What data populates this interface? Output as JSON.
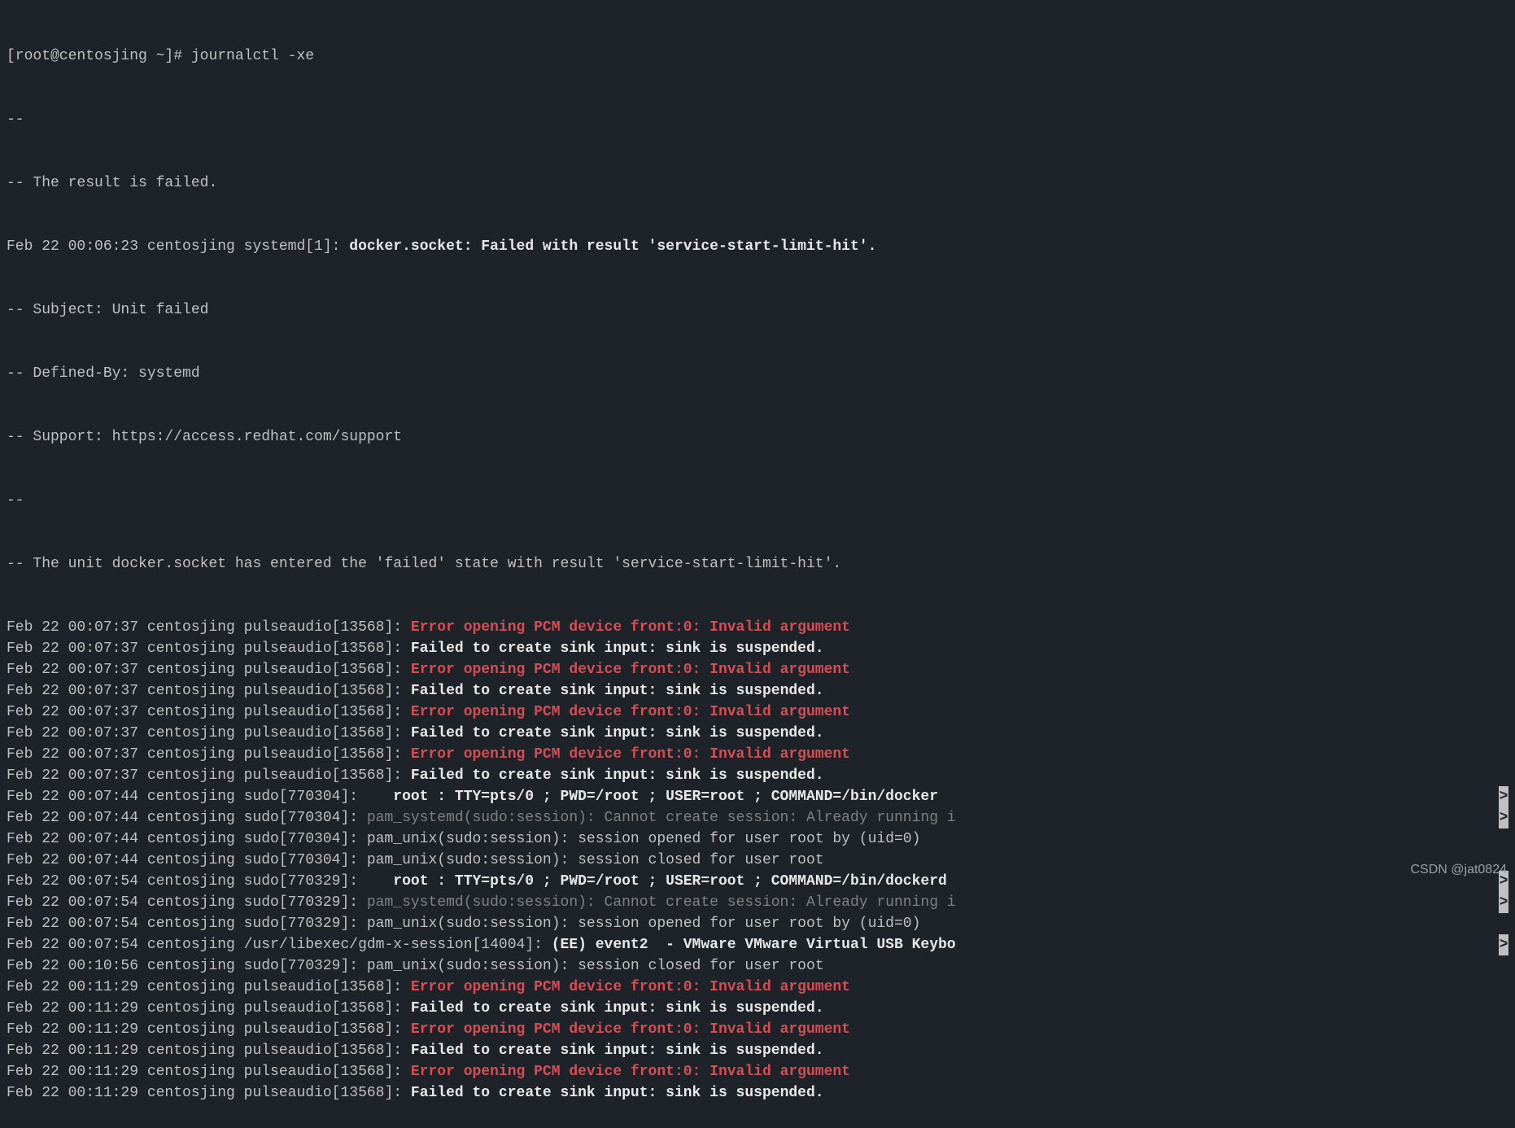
{
  "prompt": {
    "user_host": "[root@centosjing ~]# ",
    "command": "journalctl -xe"
  },
  "header": {
    "sep1": "--",
    "result": "-- The result is failed.",
    "docker_prefix": "Feb 22 00:06:23 centosjing systemd[1]: ",
    "docker_msg": "docker.socket: Failed with result 'service-start-limit-hit'.",
    "subject": "-- Subject: Unit failed",
    "defined": "-- Defined-By: systemd",
    "support": "-- Support: https://access.redhat.com/support",
    "sep2": "--",
    "unit_msg": "-- The unit docker.socket has entered the 'failed' state with result 'service-start-limit-hit'."
  },
  "lines": [
    {
      "prefix": "Feb 22 00:07:37 centosjing pulseaudio[13568]: ",
      "msg": "Error opening PCM device front:0: Invalid argument",
      "cls": "red-bold"
    },
    {
      "prefix": "Feb 22 00:07:37 centosjing pulseaudio[13568]: ",
      "msg": "Failed to create sink input: sink is suspended.",
      "cls": "bold"
    },
    {
      "prefix": "Feb 22 00:07:37 centosjing pulseaudio[13568]: ",
      "msg": "Error opening PCM device front:0: Invalid argument",
      "cls": "red-bold"
    },
    {
      "prefix": "Feb 22 00:07:37 centosjing pulseaudio[13568]: ",
      "msg": "Failed to create sink input: sink is suspended.",
      "cls": "bold"
    },
    {
      "prefix": "Feb 22 00:07:37 centosjing pulseaudio[13568]: ",
      "msg": "Error opening PCM device front:0: Invalid argument",
      "cls": "red-bold"
    },
    {
      "prefix": "Feb 22 00:07:37 centosjing pulseaudio[13568]: ",
      "msg": "Failed to create sink input: sink is suspended.",
      "cls": "bold"
    },
    {
      "prefix": "Feb 22 00:07:37 centosjing pulseaudio[13568]: ",
      "msg": "Error opening PCM device front:0: Invalid argument",
      "cls": "red-bold"
    },
    {
      "prefix": "Feb 22 00:07:37 centosjing pulseaudio[13568]: ",
      "msg": "Failed to create sink input: sink is suspended.",
      "cls": "bold"
    },
    {
      "prefix": "Feb 22 00:07:44 centosjing sudo[770304]:    ",
      "msg": "root : TTY=pts/0 ; PWD=/root ; USER=root ; COMMAND=/bin/docker ",
      "cls": "bold",
      "trunc": true
    },
    {
      "prefix": "Feb 22 00:07:44 centosjing sudo[770304]: ",
      "msg": "pam_systemd(sudo:session): Cannot create session: Already running i",
      "cls": "gray",
      "trunc": true
    },
    {
      "prefix": "Feb 22 00:07:44 centosjing sudo[770304]: ",
      "msg": "pam_unix(sudo:session): session opened for user root by (uid=0)",
      "cls": ""
    },
    {
      "prefix": "Feb 22 00:07:44 centosjing sudo[770304]: ",
      "msg": "pam_unix(sudo:session): session closed for user root",
      "cls": ""
    },
    {
      "prefix": "Feb 22 00:07:54 centosjing sudo[770329]:    ",
      "msg": "root : TTY=pts/0 ; PWD=/root ; USER=root ; COMMAND=/bin/dockerd",
      "cls": "bold",
      "trunc": true
    },
    {
      "prefix": "Feb 22 00:07:54 centosjing sudo[770329]: ",
      "msg": "pam_systemd(sudo:session): Cannot create session: Already running i",
      "cls": "gray",
      "trunc": true
    },
    {
      "prefix": "Feb 22 00:07:54 centosjing sudo[770329]: ",
      "msg": "pam_unix(sudo:session): session opened for user root by (uid=0)",
      "cls": ""
    },
    {
      "prefix": "Feb 22 00:07:54 centosjing /usr/libexec/gdm-x-session[14004]: ",
      "msg": "(EE) event2  - VMware VMware Virtual USB Keybo",
      "cls": "bold",
      "trunc": true
    },
    {
      "prefix": "Feb 22 00:10:56 centosjing sudo[770329]: ",
      "msg": "pam_unix(sudo:session): session closed for user root",
      "cls": ""
    },
    {
      "prefix": "Feb 22 00:11:29 centosjing pulseaudio[13568]: ",
      "msg": "Error opening PCM device front:0: Invalid argument",
      "cls": "red-bold"
    },
    {
      "prefix": "Feb 22 00:11:29 centosjing pulseaudio[13568]: ",
      "msg": "Failed to create sink input: sink is suspended.",
      "cls": "bold"
    },
    {
      "prefix": "Feb 22 00:11:29 centosjing pulseaudio[13568]: ",
      "msg": "Error opening PCM device front:0: Invalid argument",
      "cls": "red-bold"
    },
    {
      "prefix": "Feb 22 00:11:29 centosjing pulseaudio[13568]: ",
      "msg": "Failed to create sink input: sink is suspended.",
      "cls": "bold"
    },
    {
      "prefix": "Feb 22 00:11:29 centosjing pulseaudio[13568]: ",
      "msg": "Error opening PCM device front:0: Invalid argument",
      "cls": "red-bold"
    },
    {
      "prefix": "Feb 22 00:11:29 centosjing pulseaudio[13568]: ",
      "msg": "Failed to create sink input: sink is suspended.",
      "cls": "bold"
    }
  ],
  "trunc_glyph": ">",
  "watermark": "CSDN @jat0824"
}
